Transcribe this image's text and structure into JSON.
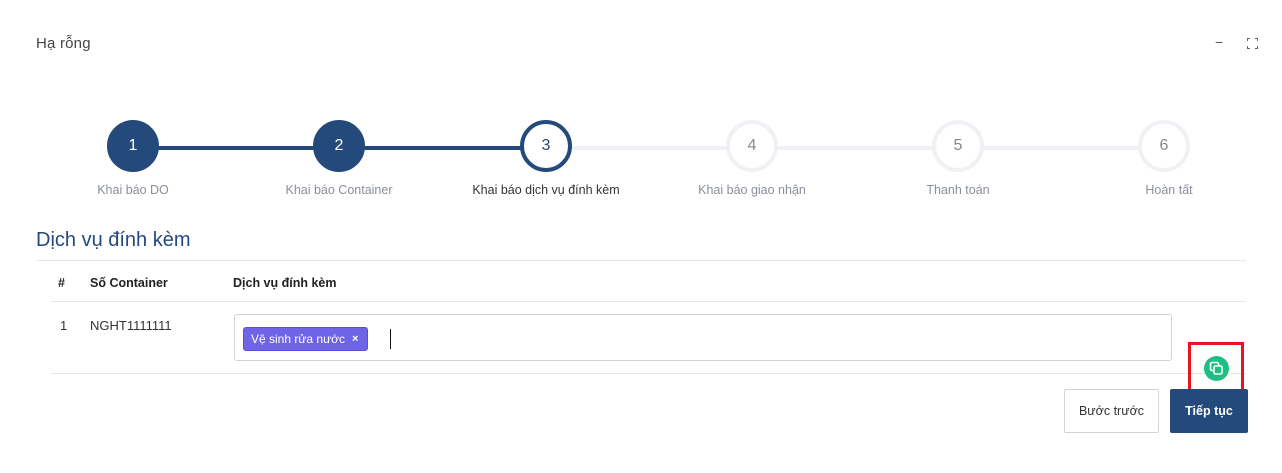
{
  "window": {
    "title": "Hạ rỗng",
    "minimize_label": "−"
  },
  "stepper": {
    "steps": [
      {
        "number": "1",
        "label": "Khai báo DO",
        "state": "done"
      },
      {
        "number": "2",
        "label": "Khai báo Container",
        "state": "done"
      },
      {
        "number": "3",
        "label": "Khai báo dịch vụ đính kèm",
        "state": "active"
      },
      {
        "number": "4",
        "label": "Khai báo giao nhận",
        "state": "todo"
      },
      {
        "number": "5",
        "label": "Thanh toán",
        "state": "todo"
      },
      {
        "number": "6",
        "label": "Hoàn tất",
        "state": "todo"
      }
    ]
  },
  "section": {
    "title": "Dịch vụ đính kèm"
  },
  "table": {
    "headers": {
      "index": "#",
      "container": "Số Container",
      "services": "Dịch vụ đính kèm"
    },
    "rows": [
      {
        "index": "1",
        "container": "NGHT1111111",
        "tags": [
          "Vệ sinh rửa nước"
        ],
        "tag_remove": "×"
      }
    ]
  },
  "buttons": {
    "back": "Bước trước",
    "next": "Tiếp tục"
  },
  "colors": {
    "primary": "#244a7c",
    "tag": "#6f63e8",
    "copy": "#1dbf83",
    "highlight": "#e8141f",
    "inactive": "#f0f1f4"
  },
  "icons": {
    "copy": "copy-icon",
    "remove_tag": "close-icon",
    "maximize": "maximize-icon"
  }
}
